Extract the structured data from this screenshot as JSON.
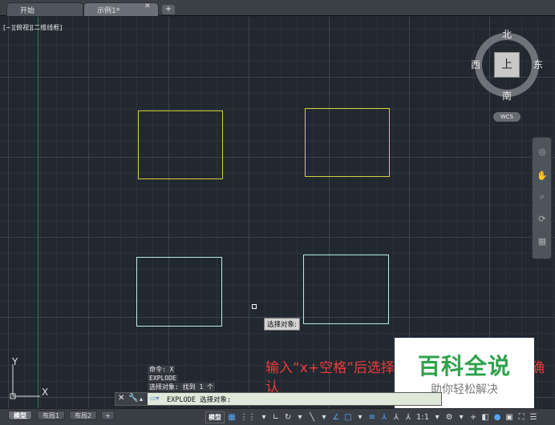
{
  "tabs": {
    "start_label": "开始",
    "drawing_label": "示例1*",
    "close_glyph": "✕",
    "new_glyph": "+"
  },
  "viewport": {
    "label": "[−][俯视][二维线框]"
  },
  "viewcube": {
    "north": "北",
    "south": "南",
    "east": "东",
    "west": "西",
    "face": "上",
    "wcs_label": "WCS"
  },
  "ucs": {
    "x_label": "X",
    "y_label": "Y"
  },
  "tooltip": {
    "text": "选择对象:"
  },
  "command_history": [
    "命令: X",
    "EXPLODE",
    "选择对象: 找到 1 个"
  ],
  "command_line": {
    "text": "EXPLODE 选择对象:"
  },
  "annotation": {
    "text": "输入“x+空格”后选择需要分解的图形，右键确认"
  },
  "watermark": {
    "title": "百科全说",
    "subtitle": "助你轻松解决"
  },
  "layout_tabs": {
    "model": "模型",
    "layout1": "布局1",
    "layout2": "布局2",
    "add": "+"
  },
  "status": {
    "model_label": "模型",
    "scale_label": "1:1"
  },
  "colors": {
    "canvas_bg": "#212830",
    "yellow_rect": "#d6d13a",
    "cyan_rect": "#b9ece4",
    "annotation": "#ef3b3b",
    "watermark_green": "#2ea24a"
  }
}
